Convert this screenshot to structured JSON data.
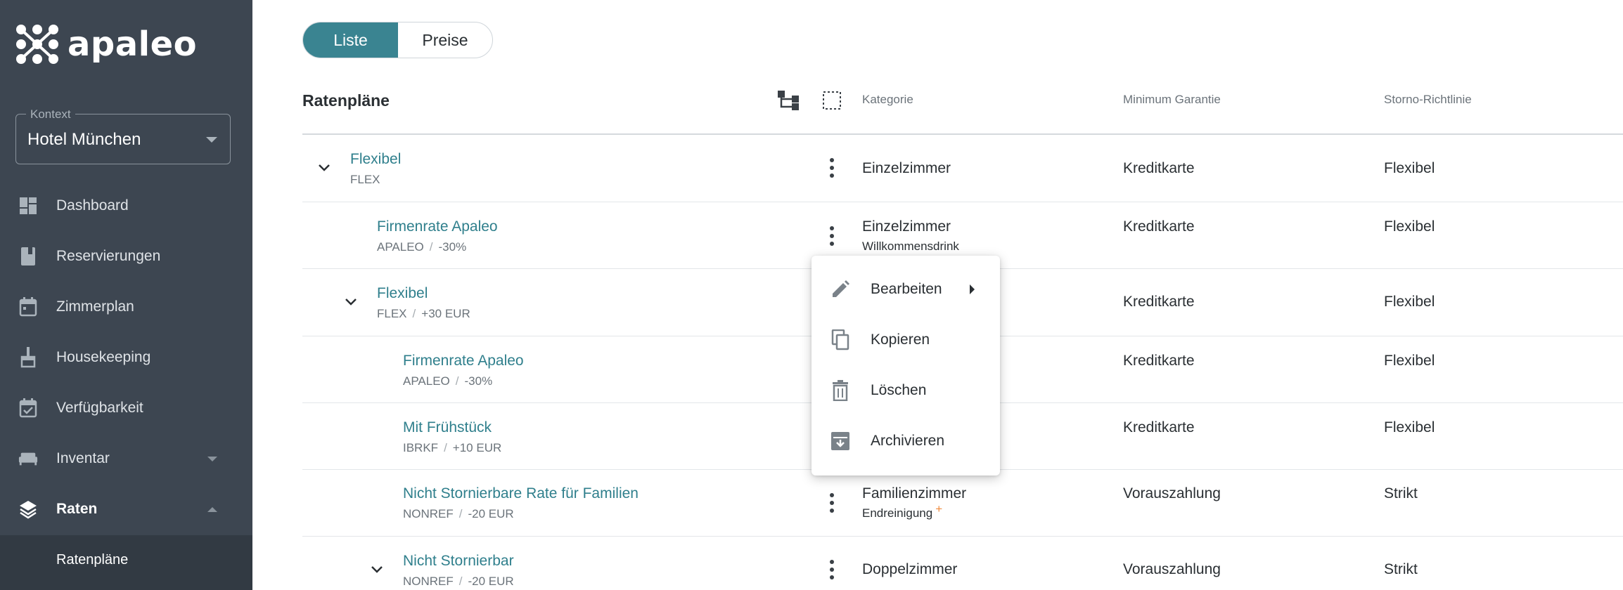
{
  "app": {
    "name": "apaleo"
  },
  "context": {
    "label": "Kontext",
    "value": "Hotel München"
  },
  "nav": [
    {
      "label": "Dashboard",
      "icon": "dashboard-icon"
    },
    {
      "label": "Reservierungen",
      "icon": "book-icon"
    },
    {
      "label": "Zimmerplan",
      "icon": "calendar-icon"
    },
    {
      "label": "Housekeeping",
      "icon": "broom-icon"
    },
    {
      "label": "Verfügbarkeit",
      "icon": "calendar-check-icon"
    },
    {
      "label": "Inventar",
      "icon": "bed-icon",
      "expandable": true
    },
    {
      "label": "Raten",
      "icon": "layers-icon",
      "expanded": true,
      "active": true
    }
  ],
  "subnav": {
    "label": "Ratenpläne"
  },
  "toggle": {
    "options": [
      "Liste",
      "Preise"
    ],
    "selected": "Liste"
  },
  "list": {
    "title": "Ratenpläne",
    "columns": [
      "Kategorie",
      "Minimum Garantie",
      "Storno-Richtlinie"
    ],
    "rows": [
      {
        "name": "Flexibel",
        "code": "FLEX",
        "modifier": "",
        "category": "Einzelzimmer",
        "extra": "",
        "guarantee": "Kreditkarte",
        "cancellation": "Flexibel",
        "expanded": true
      },
      {
        "name": "Firmenrate Apaleo",
        "code": "APALEO",
        "modifier": "-30%",
        "category": "Einzelzimmer",
        "extra": "Willkommensdrink",
        "guarantee": "Kreditkarte",
        "cancellation": "Flexibel"
      },
      {
        "name": "Flexibel",
        "code": "FLEX",
        "modifier": "+30 EUR",
        "category": "",
        "extra": "",
        "guarantee": "Kreditkarte",
        "cancellation": "Flexibel",
        "expanded": true
      },
      {
        "name": "Firmenrate Apaleo",
        "code": "APALEO",
        "modifier": "-30%",
        "category": "",
        "extra": "",
        "guarantee": "Kreditkarte",
        "cancellation": "Flexibel"
      },
      {
        "name": "Mit Frühstück",
        "code": "IBRKF",
        "modifier": "+10 EUR",
        "category": "",
        "extra": "",
        "guarantee": "Kreditkarte",
        "cancellation": "Flexibel"
      },
      {
        "name": "Nicht Stornierbare Rate für Familien",
        "code": "NONREF",
        "modifier": "-20 EUR",
        "category": "Familienzimmer",
        "extra": "Endreinigung",
        "extra_badge": "+",
        "guarantee": "Vorauszahlung",
        "cancellation": "Strikt"
      },
      {
        "name": "Nicht Stornierbar",
        "code": "NONREF",
        "modifier": "-20 EUR",
        "category": "Doppelzimmer",
        "extra": "",
        "guarantee": "Vorauszahlung",
        "cancellation": "Strikt",
        "expanded": true
      }
    ]
  },
  "menu": {
    "items": [
      {
        "label": "Bearbeiten",
        "icon": "pencil-icon",
        "submenu": true
      },
      {
        "label": "Kopieren",
        "icon": "copy-icon"
      },
      {
        "label": "Löschen",
        "icon": "trash-icon"
      },
      {
        "label": "Archivieren",
        "icon": "archive-icon"
      }
    ]
  },
  "colors": {
    "sidebar": "#3d4651",
    "accent": "#3a8491",
    "link": "#2f7f8c",
    "badge": "#f08a3c"
  }
}
